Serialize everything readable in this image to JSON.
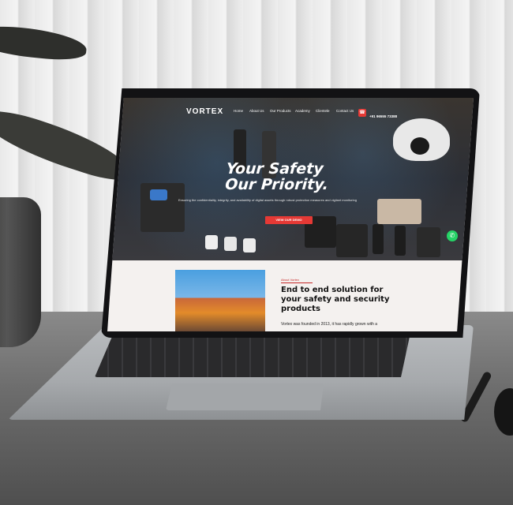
{
  "site": {
    "logo": "VORTEX",
    "nav": [
      "Home",
      "About Us",
      "Our Products",
      "Academy",
      "Clientele",
      "Contact Us"
    ],
    "phone": "+91 96555 73388",
    "headline_line1": "Your Safety",
    "headline_line2": "Our Priority.",
    "tagline": "Ensuring the confidentiality, integrity, and availability of digital assets through robust protection measures and vigilant monitoring",
    "cta_label": "VIEW OUR DEMO",
    "about": {
      "label": "About Vortex",
      "title_line1": "End to end solution for",
      "title_line2": "your safety and security",
      "title_line3": "products",
      "text": "Vortex was founded in 2013, it has rapidly grown with a"
    }
  },
  "icons": {
    "phone": "phone-icon",
    "whatsapp": "whatsapp-icon"
  },
  "colors": {
    "accent": "#e53935",
    "whatsapp": "#25d366"
  }
}
